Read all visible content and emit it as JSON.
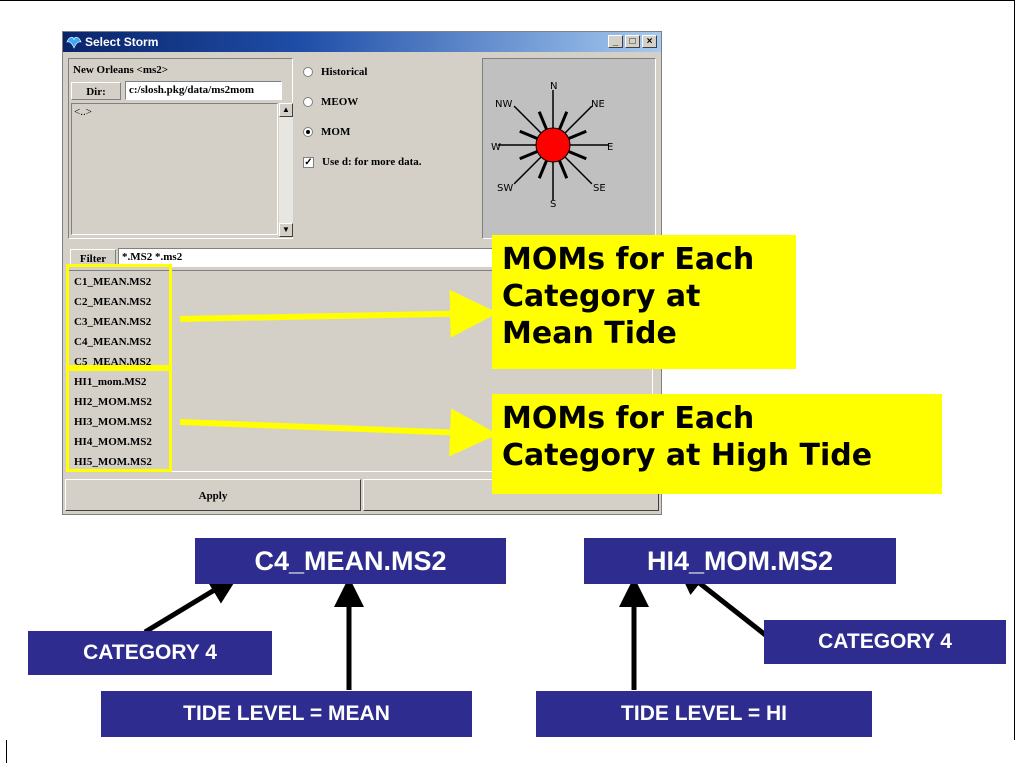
{
  "window": {
    "title": "Select Storm",
    "buttons": [
      "_",
      "□",
      "×"
    ]
  },
  "location": "New Orleans <ms2>",
  "dir_label": "Dir:",
  "dir_value": "c:/slosh.pkg/data/ms2mom",
  "dir_list": [
    "<..>"
  ],
  "options": {
    "historical": "Historical",
    "meow": "MEOW",
    "mom": "MOM",
    "use_d": "Use d: for more data."
  },
  "compass": {
    "n": "N",
    "ne": "NE",
    "e": "E",
    "se": "SE",
    "s": "S",
    "sw": "SW",
    "w": "W",
    "nw": "NW"
  },
  "filter_label": "Filter",
  "filter_value": "*.MS2 *.ms2",
  "files": [
    "C1_MEAN.MS2",
    "C2_MEAN.MS2",
    "C3_MEAN.MS2",
    "C4_MEAN.MS2",
    "C5_MEAN.MS2",
    "HI1_mom.MS2",
    "HI2_MOM.MS2",
    "HI3_MOM.MS2",
    "HI4_MOM.MS2",
    "HI5_MOM.MS2"
  ],
  "apply_label": "Apply",
  "callouts": {
    "mean_line1": "MOMs for Each",
    "mean_line2": "Category at",
    "mean_line3": "Mean Tide",
    "high_line1": "MOMs for Each",
    "high_line2": "Category at High Tide"
  },
  "examples": {
    "mean_file": "C4_MEAN.MS2",
    "hi_file": "HI4_MOM.MS2",
    "category_left": "CATEGORY 4",
    "category_right": "CATEGORY 4",
    "tide_mean": "TIDE LEVEL = MEAN",
    "tide_hi": "TIDE LEVEL = HI"
  },
  "colors": {
    "highlight": "#ffff00",
    "label_bg": "#2e2d8f",
    "compass_center": "#ff0000"
  }
}
